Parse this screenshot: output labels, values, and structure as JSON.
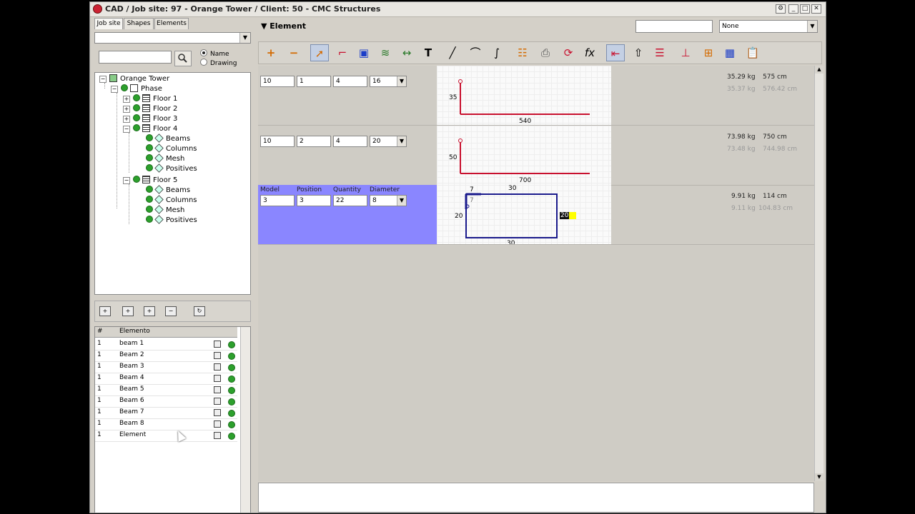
{
  "window": {
    "title": "CAD / Job site: 97 - Orange Tower / Client: 50 - CMC Structures"
  },
  "left": {
    "tabs": [
      "Job site",
      "Shapes",
      "Elements"
    ],
    "radio": {
      "name": "Name",
      "drawing": "Drawing"
    },
    "tree": {
      "root": "Orange Tower",
      "phase": "Phase",
      "floors": [
        "Floor 1",
        "Floor 2",
        "Floor 3",
        "Floor 4"
      ],
      "floor4_children": [
        "Beams",
        "Columns",
        "Mesh",
        "Positives"
      ],
      "floor5": "Floor 5",
      "floor5_children": [
        "Beams",
        "Columns",
        "Mesh",
        "Positives"
      ]
    },
    "list": {
      "headers": {
        "num": "#",
        "name": "Elemento"
      },
      "rows": [
        {
          "n": "1",
          "name": "beam 1"
        },
        {
          "n": "1",
          "name": "Beam 2"
        },
        {
          "n": "1",
          "name": "Beam 3"
        },
        {
          "n": "1",
          "name": "Beam 4"
        },
        {
          "n": "1",
          "name": "Beam 5"
        },
        {
          "n": "1",
          "name": "Beam 6"
        },
        {
          "n": "1",
          "name": "Beam 7"
        },
        {
          "n": "1",
          "name": "Beam 8"
        },
        {
          "n": "1",
          "name": "Element"
        }
      ]
    }
  },
  "right": {
    "header": {
      "title": "Element",
      "select_value": "None"
    },
    "field_labels": {
      "model": "Model",
      "position": "Position",
      "quantity": "Quantity",
      "diameter": "Diameter"
    },
    "rows": [
      {
        "model": "10",
        "position": "1",
        "quantity": "4",
        "diameter": "16",
        "dim_v": "35",
        "dim_h": "540",
        "w1": "35.29 kg",
        "len1": "575 cm",
        "w2": "35.37 kg",
        "len2": "576.42 cm"
      },
      {
        "model": "10",
        "position": "2",
        "quantity": "4",
        "diameter": "20",
        "dim_v": "50",
        "dim_h": "700",
        "w1": "73.98 kg",
        "len1": "750 cm",
        "w2": "73.48 kg",
        "len2": "744.98 cm"
      },
      {
        "model": "3",
        "position": "3",
        "quantity": "22",
        "diameter": "8",
        "dim_hook": "7",
        "dim_hook2": "7",
        "dim_top": "30",
        "dim_left": "20",
        "dim_right": "20",
        "dim_bottom": "30",
        "w1": "9.91 kg",
        "len1": "114 cm",
        "w2": "9.11 kg",
        "len2": "104.83 cm"
      }
    ]
  },
  "colors": {
    "selected_row": "#8a86ff",
    "bar_red": "#c8102e",
    "stirrup_blue": "#1a1a8c",
    "status_green": "#2ca02c"
  }
}
